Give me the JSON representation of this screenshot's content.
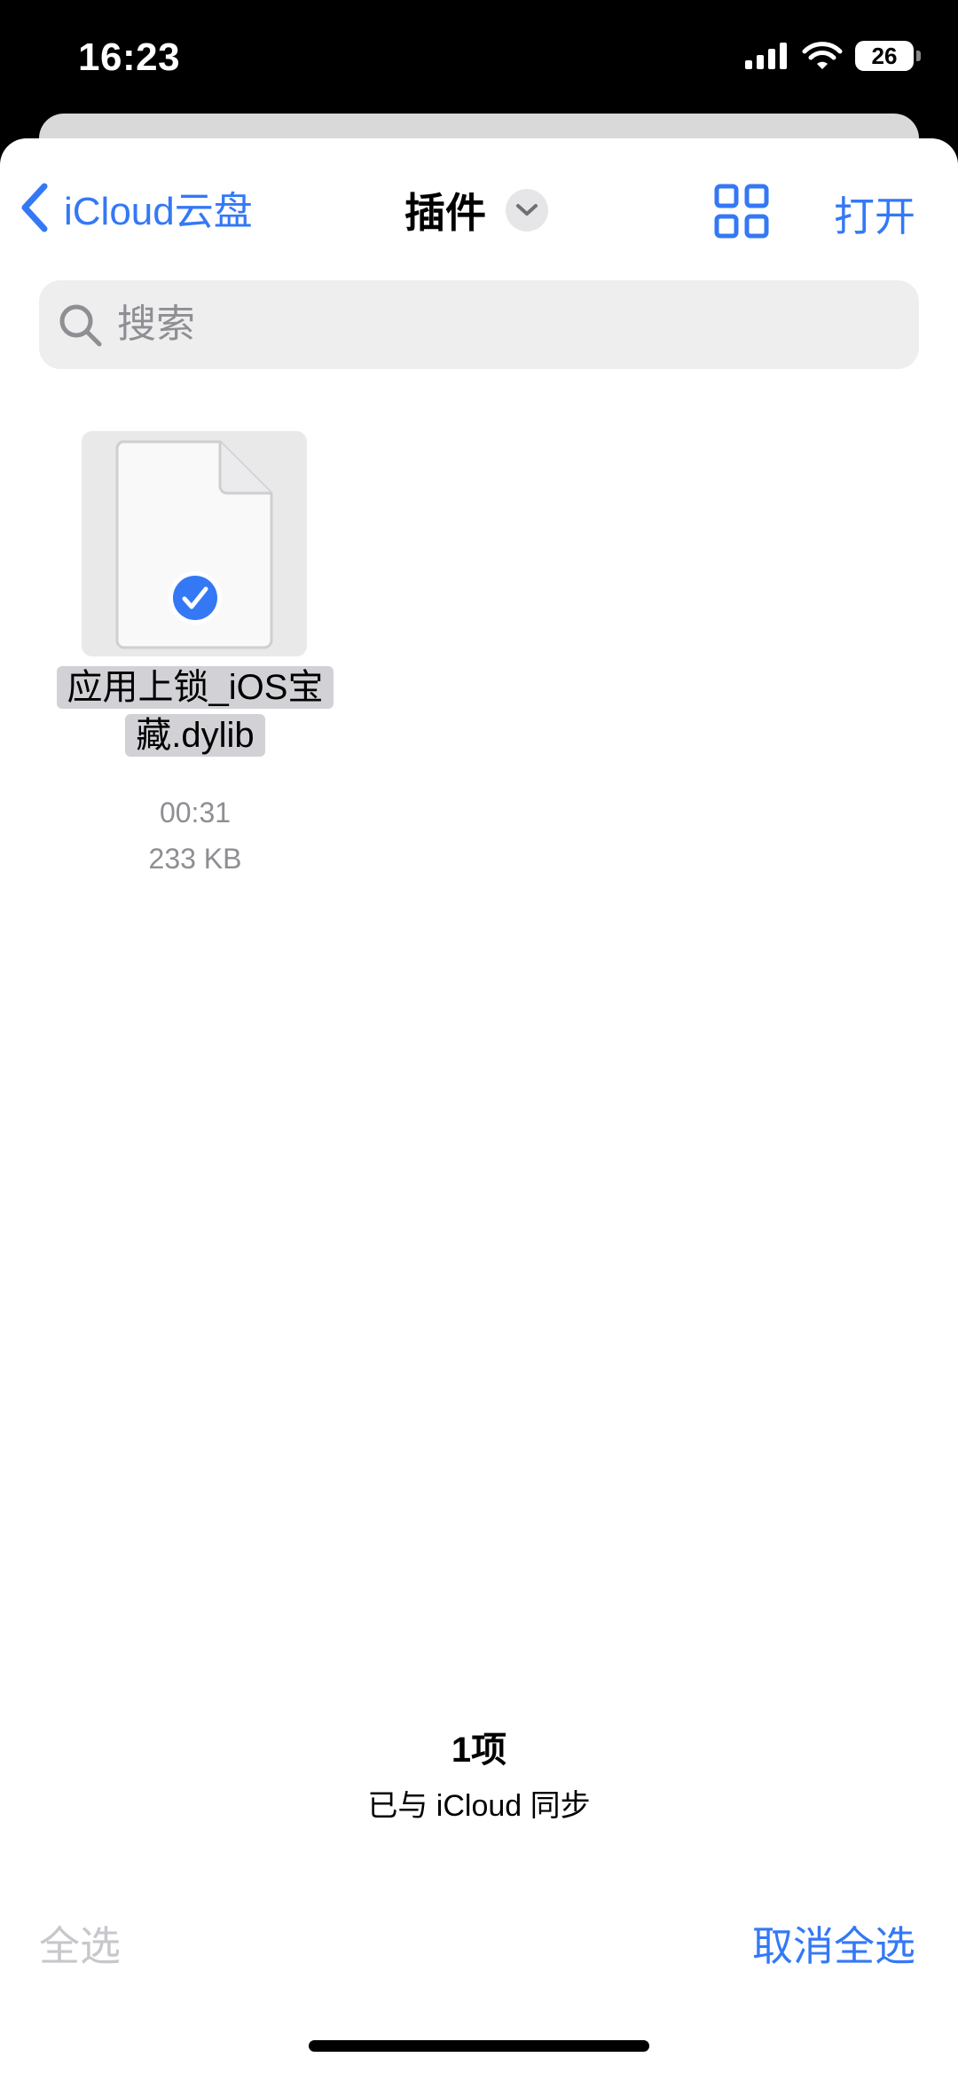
{
  "status_bar": {
    "time": "16:23",
    "battery": "26"
  },
  "nav": {
    "back_label": "iCloud云盘",
    "title": "插件",
    "open_label": "打开"
  },
  "search": {
    "placeholder": "搜索"
  },
  "files": [
    {
      "name": "应用上锁_iOS宝藏.dylib",
      "time": "00:31",
      "size": "233 KB",
      "selected": true
    }
  ],
  "footer": {
    "count": "1项",
    "sync_status": "已与 iCloud 同步",
    "select_all": "全选",
    "deselect_all": "取消全选"
  },
  "colors": {
    "accent": "#3478f6",
    "disabled": "#c7c7cc",
    "secondary_text": "#8e8e93"
  }
}
